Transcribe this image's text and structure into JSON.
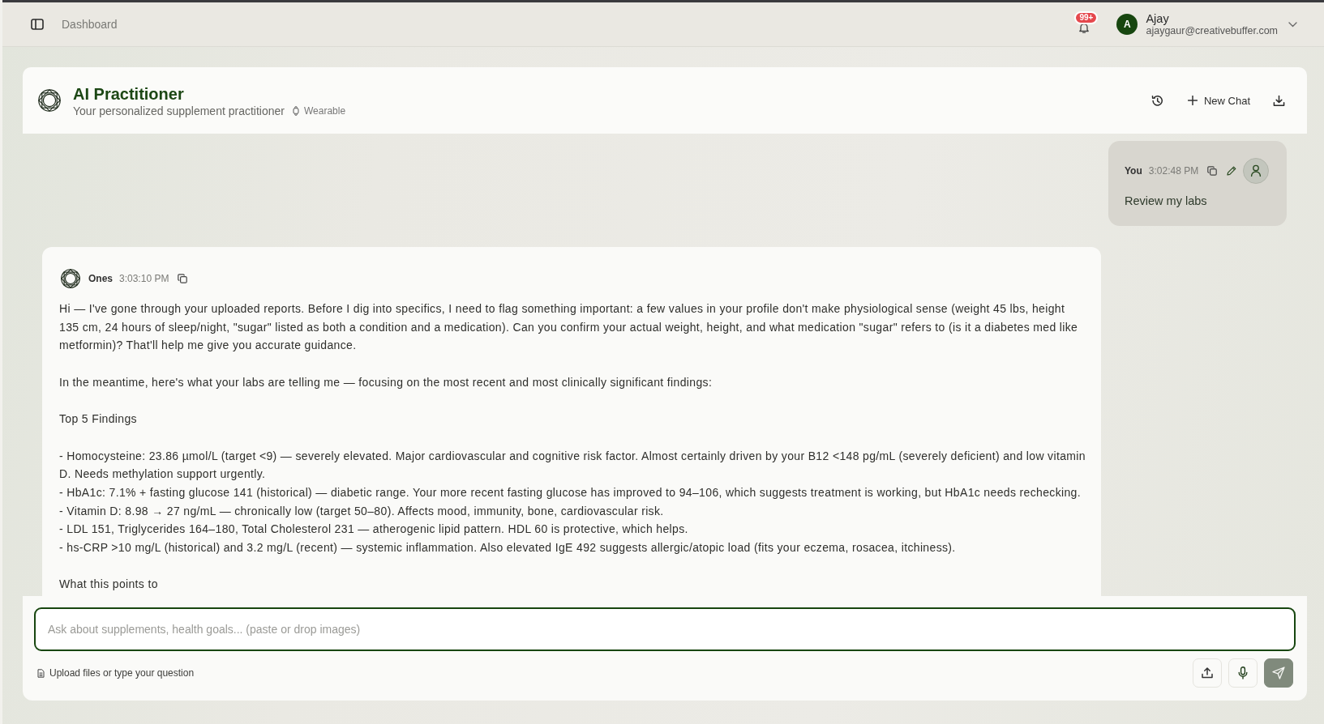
{
  "top_bar": {
    "breadcrumb": "Dashboard",
    "notification_count": "99+",
    "user": {
      "initial": "A",
      "name": "Ajay",
      "email": "ajaygaur@creativebuffer.com"
    }
  },
  "header": {
    "title": "AI Practitioner",
    "subtitle": "Your personalized supplement practitioner",
    "tag": "Wearable",
    "new_chat_label": "New Chat"
  },
  "messages": [
    {
      "kind": "user",
      "sender": "You",
      "time": "3:02:48 PM",
      "blocks": [
        [
          "Review my labs"
        ]
      ]
    },
    {
      "kind": "assistant",
      "sender": "Ones",
      "time": "3:03:10 PM",
      "blocks": [
        [
          "Hi — I've gone through your uploaded reports. Before I dig into specifics, I need to flag something important: a few values in your profile don't make physiological sense (weight 45 lbs, height 135 cm, 24 hours of sleep/night, \"sugar\" listed as both a condition and a medication). Can you confirm your actual weight, height, and what medication \"sugar\" refers to (is it a diabetes med like metformin)? That'll help me give you accurate guidance."
        ],
        [
          "In the meantime, here's what your labs are telling me — focusing on the most recent and most clinically significant findings:"
        ],
        [
          "Top 5 Findings"
        ],
        [
          "- Homocysteine: 23.86 µmol/L (target <9) — severely elevated. Major cardiovascular and cognitive risk factor. Almost certainly driven by your B12 <148 pg/mL (severely deficient) and low vitamin D. Needs methylation support urgently.",
          "- HbA1c: 7.1% + fasting glucose 141 (historical) — diabetic range. Your more recent fasting glucose has improved to 94–106, which suggests treatment is working, but HbA1c needs rechecking.",
          "- Vitamin D: 8.98 → 27 ng/mL — chronically low (target 50–80). Affects mood, immunity, bone, cardiovascular risk.",
          "- LDL 151, Triglycerides 164–180, Total Cholesterol 231 — atherogenic lipid pattern. HDL 60 is protective, which helps.",
          "- hs-CRP >10 mg/L (historical) and 3.2 mg/L (recent) — systemic inflammation. Also elevated IgE 492 suggests allergic/atopic load (fits your eczema, rosacea, itchiness)."
        ],
        [
          "What this points to"
        ]
      ]
    }
  ],
  "composer": {
    "placeholder": "Ask about supplements, health goals... (paste or drop images)",
    "hint": "Upload files or type your question",
    "send_disabled": true
  }
}
